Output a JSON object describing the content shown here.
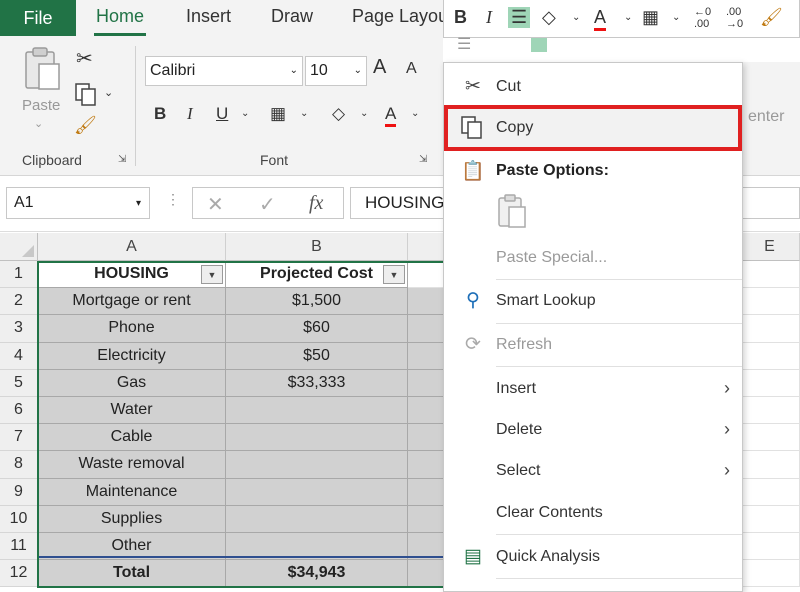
{
  "ribbon_tabs": {
    "file": "File",
    "home": "Home",
    "insert": "Insert",
    "draw": "Draw",
    "page_layout": "Page Layou"
  },
  "accent_color": "#217346",
  "ribbon": {
    "paste_label": "Paste",
    "clipboard_group": "Clipboard",
    "font_group": "Font",
    "font_name": "Calibri",
    "font_size": "10",
    "bold": "B",
    "italic": "I",
    "underline": "U",
    "grow_font": "A",
    "shrink_font": "A",
    "font_color_letter": "A",
    "alignment_ghost": "enter"
  },
  "mini_toolbar": {
    "bold": "B",
    "italic": "I",
    "font_color_letter": "A",
    "increase_decimal": "←0 .00",
    "decrease_decimal": ".00 →0"
  },
  "formula_bar": {
    "name_box": "A1",
    "fx": "fx",
    "value": "HOUSING"
  },
  "columns": [
    "A",
    "B",
    "E"
  ],
  "rows": [
    {
      "num": "1",
      "a": "HOUSING",
      "b": "Projected Cost"
    },
    {
      "num": "2",
      "a": "Mortgage or rent",
      "b": "$1,500"
    },
    {
      "num": "3",
      "a": "Phone",
      "b": "$60"
    },
    {
      "num": "4",
      "a": "Electricity",
      "b": "$50"
    },
    {
      "num": "5",
      "a": "Gas",
      "b": "$33,333"
    },
    {
      "num": "6",
      "a": "Water",
      "b": ""
    },
    {
      "num": "7",
      "a": "Cable",
      "b": ""
    },
    {
      "num": "8",
      "a": "Waste removal",
      "b": ""
    },
    {
      "num": "9",
      "a": "Maintenance",
      "b": ""
    },
    {
      "num": "10",
      "a": "Supplies",
      "b": ""
    },
    {
      "num": "11",
      "a": "Other",
      "b": ""
    },
    {
      "num": "12",
      "a": "Total",
      "b": "$34,943"
    }
  ],
  "context_menu": {
    "cut": "Cut",
    "copy": "Copy",
    "paste_options": "Paste Options:",
    "paste_special": "Paste Special...",
    "smart_lookup": "Smart Lookup",
    "refresh": "Refresh",
    "insert": "Insert",
    "delete": "Delete",
    "select": "Select",
    "clear_contents": "Clear Contents",
    "quick_analysis": "Quick Analysis",
    "highlight_color": "#e02020"
  }
}
